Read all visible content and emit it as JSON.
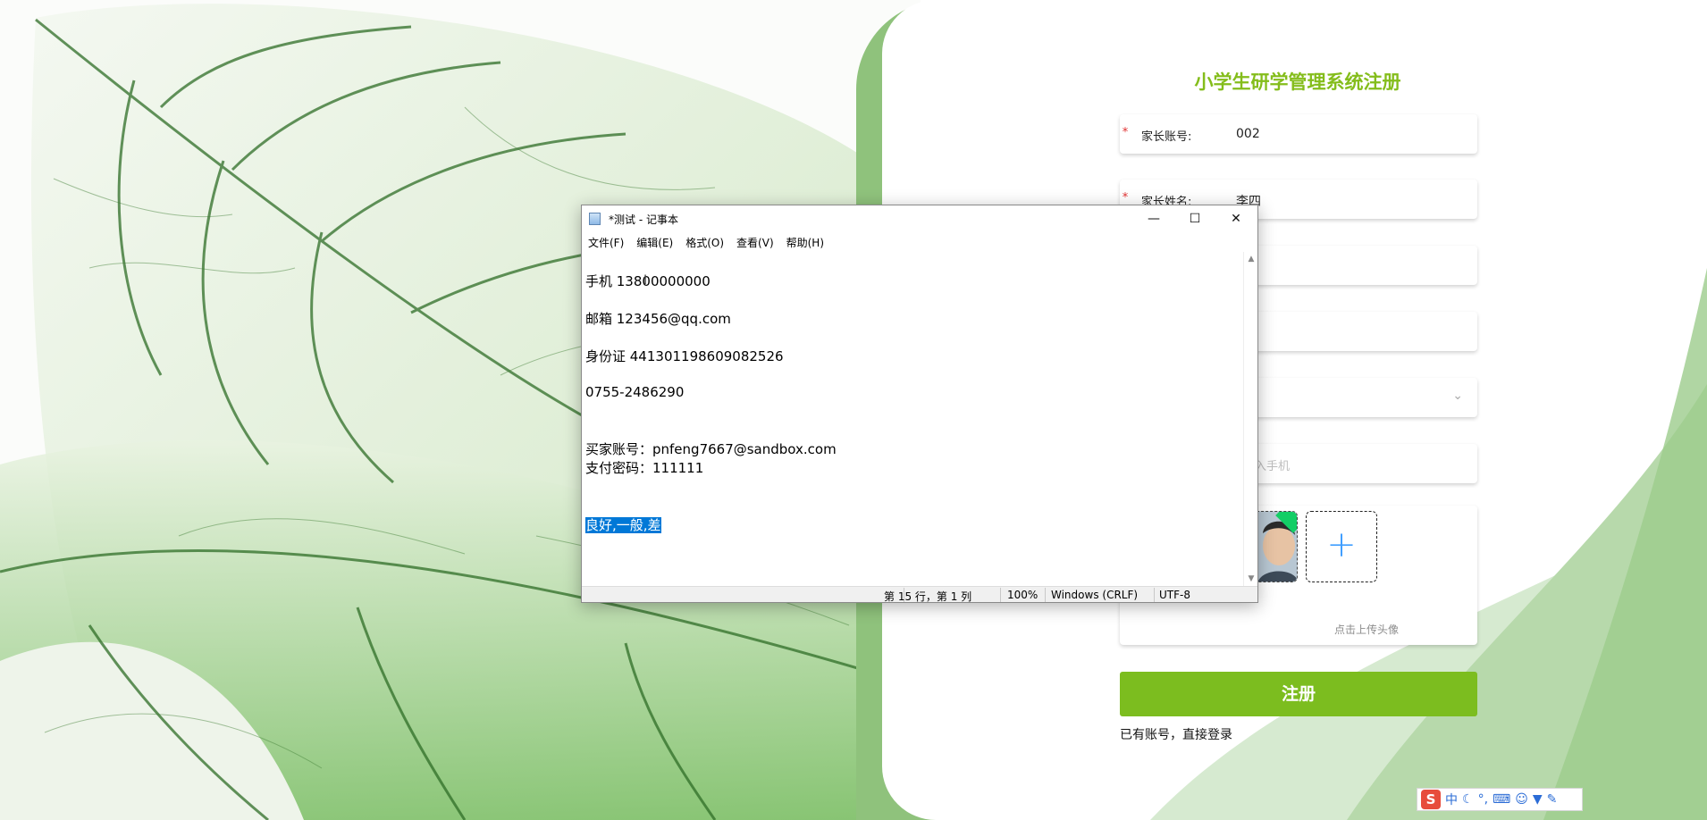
{
  "register": {
    "title": "小学生研学管理系统注册",
    "required_mark": "*",
    "fields": [
      {
        "label": "家长账号:",
        "value": "002"
      },
      {
        "label": "家长姓名:",
        "value": "李四"
      }
    ],
    "phone_placeholder_partial": "入手机",
    "upload_plus": "+",
    "upload_hint": "点击上传头像",
    "submit_label": "注册",
    "login_link": "已有账号，直接登录"
  },
  "notepad": {
    "title": "*测试 - 记事本",
    "window_buttons": {
      "minimize": "—",
      "maximize": "☐",
      "close": "✕"
    },
    "menu": [
      "文件(F)",
      "编辑(E)",
      "格式(O)",
      "查看(V)",
      "帮助(H)"
    ],
    "lines": [
      "手机 13800000000",
      "邮箱 123456@qq.com",
      "身份证 441301198609082526",
      "0755-2486290",
      "买家账号：pnfeng7667@sandbox.com",
      "支付密码：111111"
    ],
    "selected_line": "良好,一般,差",
    "status": {
      "position": "第 15 行，第 1 列",
      "zoom": "100%",
      "line_ending": "Windows (CRLF)",
      "encoding": "UTF-8"
    }
  },
  "ime_toolbar": {
    "logo": "S",
    "mode": "中",
    "items": [
      "moon-icon",
      "punctuation-icon",
      "keyboard-icon",
      "user-icon",
      "shirt-icon",
      "wrench-icon"
    ]
  },
  "colors": {
    "brand_green": "#7cbd1f",
    "title_green": "#84bd1b",
    "selection_blue": "#0078d7"
  }
}
